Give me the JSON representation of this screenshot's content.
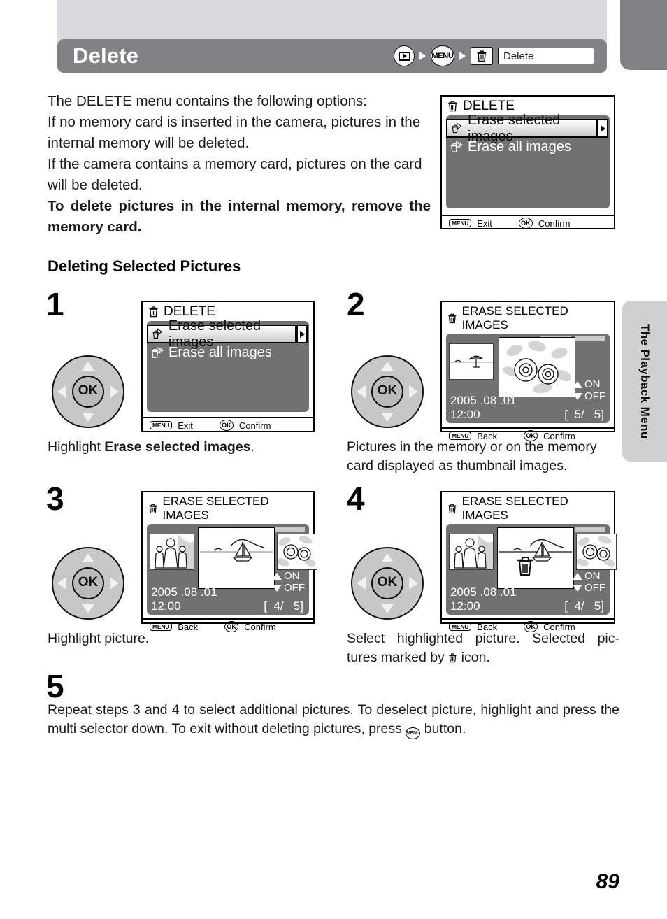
{
  "header": {
    "title": "Delete",
    "breadcrumb": {
      "playback_icon": "playback-icon",
      "menu_icon": "MENU",
      "trash_icon": "trash-icon",
      "target_label": "Delete"
    }
  },
  "intro": {
    "line1": "The DELETE menu contains the following options:",
    "line2": "If no memory card is inserted in the camera, pictures in the internal memory will be deleted.",
    "line3": "If the camera contains a memory card, pictures on the card will be deleted.",
    "line4_bold": "To delete pictures in the internal memory, remove the memory card."
  },
  "section_heading": "Deleting Selected Pictures",
  "delete_menu_screen": {
    "title": "DELETE",
    "items": [
      {
        "label": "Erase selected images",
        "selected": true
      },
      {
        "label": "Erase all images",
        "selected": false
      }
    ],
    "footer": {
      "menu_badge": "MENU",
      "menu_label": "Exit",
      "ok_badge": "OK",
      "ok_label": "Confirm"
    }
  },
  "erase_screen": {
    "title": "ERASE SELECTED IMAGES",
    "on_label": "ON",
    "off_label": "OFF",
    "date": "2005 .08 .01",
    "time": "12:00",
    "footer": {
      "menu_badge": "MENU",
      "menu_label": "Back",
      "ok_badge": "OK",
      "ok_label": "Confirm"
    }
  },
  "steps": [
    {
      "number": "1",
      "caption_plain": "Highlight ",
      "caption_bold": "Erase selected images",
      "caption_tail": ".",
      "screen": "delete_menu"
    },
    {
      "number": "2",
      "caption": "Pictures in the memory or on the memory card displayed as thumbnail images.",
      "counter": "5/",
      "counter_total": "5"
    },
    {
      "number": "3",
      "caption": "Highlight picture.",
      "counter": "4/",
      "counter_total": "5"
    },
    {
      "number": "4",
      "caption_a": "Select highlighted picture. Selected pic-",
      "caption_b_pre": "tures marked by ",
      "caption_b_post": " icon.",
      "counter": "4/",
      "counter_total": "5"
    },
    {
      "number": "5",
      "text_pre": "Repeat steps 3 and 4 to select additional pictures. To deselect picture, highlight and press the multi selector down. To exit without deleting pictures, press ",
      "text_badge": "MENU",
      "text_post": " button."
    }
  ],
  "side_tab": {
    "label": "The Playback Menu"
  },
  "page_number": "89",
  "colors": {
    "header_bar": "#808285",
    "top_band": "#d9dadd",
    "lcd_body": "#6f7173",
    "side_tab": "#cfd0d2"
  }
}
